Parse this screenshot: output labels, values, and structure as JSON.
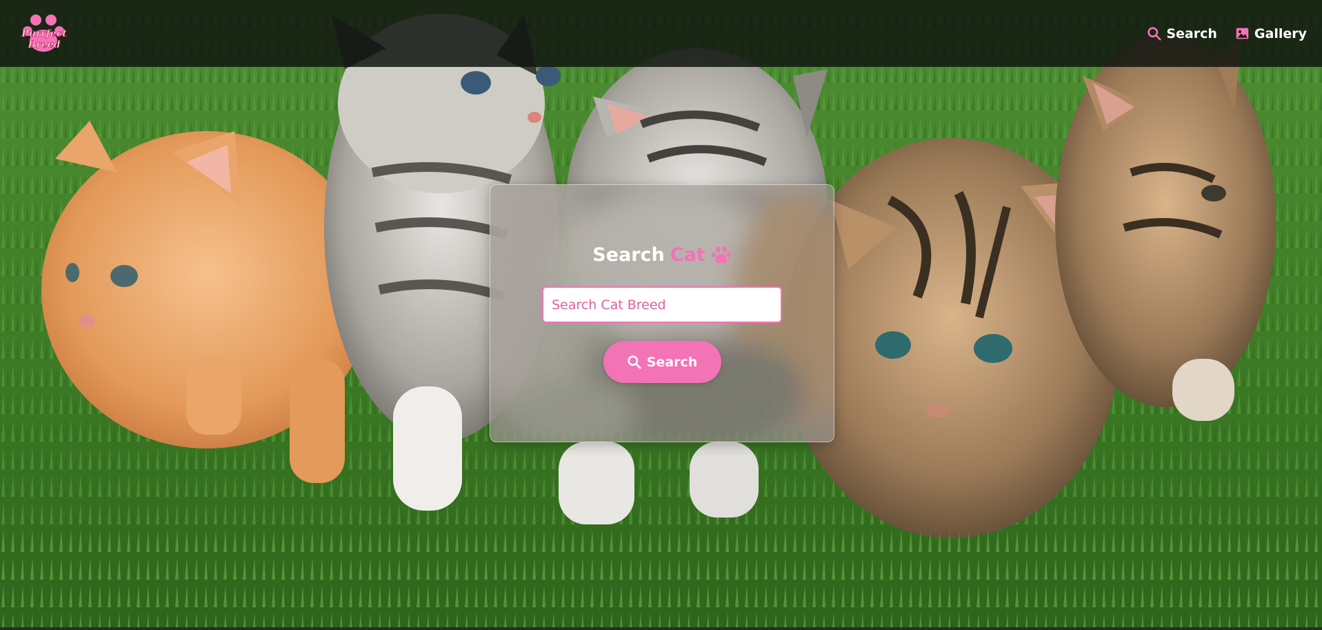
{
  "brand": {
    "logo_line1": "Purrfect",
    "logo_line2": "Breed",
    "logo_alt": "Purrfect Breed logo"
  },
  "nav": {
    "links": [
      {
        "label": "Search",
        "icon": "search-icon"
      },
      {
        "label": "Gallery",
        "icon": "image-icon"
      }
    ]
  },
  "search_card": {
    "title_prefix": "Search",
    "title_accent": "Cat",
    "title_icon": "paw-icon",
    "input": {
      "value": "",
      "placeholder": "Search Cat Breed"
    },
    "button_label": "Search",
    "button_icon": "search-icon"
  },
  "colors": {
    "accent": "#f472b6",
    "navbar_bg": "#121610",
    "text": "#ffffff"
  }
}
